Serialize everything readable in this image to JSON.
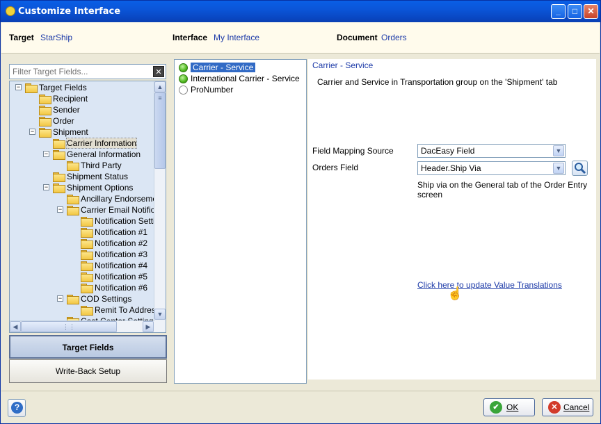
{
  "window": {
    "title": "Customize Interface",
    "controls": [
      "minimize-icon",
      "maximize-icon",
      "close-icon"
    ]
  },
  "infobar": {
    "target_label": "Target",
    "target_value": "StarShip",
    "interface_label": "Interface",
    "interface_value": "My Interface",
    "document_label": "Document",
    "document_value": "Orders"
  },
  "left_panel": {
    "filter_placeholder": "Filter Target Fields...",
    "tree": [
      {
        "label": "Target Fields",
        "level": 0,
        "expander": "−"
      },
      {
        "label": "Recipient",
        "level": 1
      },
      {
        "label": "Sender",
        "level": 1
      },
      {
        "label": "Order",
        "level": 1
      },
      {
        "label": "Shipment",
        "level": 1,
        "expander": "−"
      },
      {
        "label": "Carrier Information",
        "level": 2,
        "selected": true
      },
      {
        "label": "General Information",
        "level": 2,
        "expander": "−"
      },
      {
        "label": "Third Party",
        "level": 3
      },
      {
        "label": "Shipment Status",
        "level": 2
      },
      {
        "label": "Shipment Options",
        "level": 2,
        "expander": "−"
      },
      {
        "label": "Ancillary Endorsement",
        "level": 3
      },
      {
        "label": "Carrier Email Notificatio",
        "level": 3,
        "expander": "−"
      },
      {
        "label": "Notification Setting",
        "level": 4
      },
      {
        "label": "Notification #1",
        "level": 4
      },
      {
        "label": "Notification #2",
        "level": 4
      },
      {
        "label": "Notification #3",
        "level": 4
      },
      {
        "label": "Notification #4",
        "level": 4
      },
      {
        "label": "Notification #5",
        "level": 4
      },
      {
        "label": "Notification #6",
        "level": 4
      },
      {
        "label": "COD Settings",
        "level": 3,
        "expander": "−"
      },
      {
        "label": "Remit To Address",
        "level": 4
      },
      {
        "label": "Cost Center Settings",
        "level": 3
      }
    ],
    "nav_active": "Target Fields",
    "nav_inactive": "Write-Back Setup"
  },
  "mapping_list": [
    {
      "label": "Carrier - Service",
      "status": "mapped",
      "selected": true
    },
    {
      "label": "International Carrier - Service",
      "status": "mapped"
    },
    {
      "label": "ProNumber",
      "status": "unmapped"
    }
  ],
  "detail": {
    "header": "Carrier - Service",
    "description": "Carrier and Service in Transportation group on the 'Shipment' tab",
    "source_label": "Field Mapping Source",
    "source_value": "DacEasy Field",
    "field_label": "Orders Field",
    "field_value": "Header.Ship Via",
    "field_hint": "Ship via on the General tab of the Order Entry screen",
    "translation_link": "Click here to update Value Translations"
  },
  "footer": {
    "ok_label": "OK",
    "cancel_label": "Cancel"
  },
  "colors": {
    "titlebar": "#0a4fd0",
    "link": "#1c3aa8",
    "selection": "#316ac5"
  }
}
